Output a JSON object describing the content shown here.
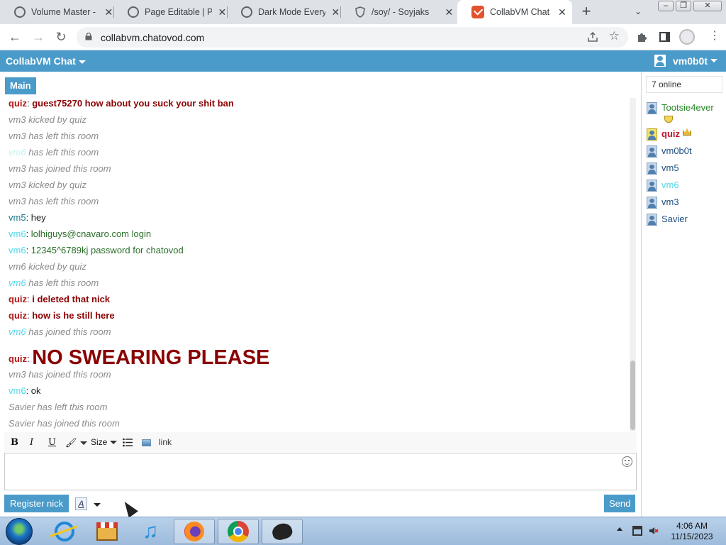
{
  "browser": {
    "tabs": [
      {
        "title": "Volume Master - h",
        "icon": "globe-icon"
      },
      {
        "title": "Page Editable | Pe",
        "icon": "globe-icon"
      },
      {
        "title": "Dark Mode Everyw",
        "icon": "globe-icon"
      },
      {
        "title": "/soy/ - Soyjaks",
        "icon": "shield-icon"
      },
      {
        "title": "CollabVM Chat",
        "icon": "collabvm-icon",
        "active": true
      }
    ],
    "new_tab_label": "+",
    "url": "collabvm.chatovod.com",
    "window_buttons": [
      "–",
      "❐",
      "✕"
    ]
  },
  "app": {
    "title": "CollabVM Chat",
    "username": "vm0b0t",
    "room_tab": "Main"
  },
  "messages": [
    {
      "type": "chat",
      "nick": "quiz",
      "text": "guest75270 how about you suck your shit ban",
      "nick_color": "#b01515",
      "text_color": "#8b0000",
      "style": "bold"
    },
    {
      "type": "system",
      "nick": "vm3",
      "text": "kicked by quiz"
    },
    {
      "type": "system",
      "nick": "vm3",
      "text": "has left this room"
    },
    {
      "type": "system",
      "nick": "vm6",
      "text": "has left this room",
      "nick_color": "#c9eef4"
    },
    {
      "type": "system",
      "nick": "vm3",
      "text": "has joined this room"
    },
    {
      "type": "system",
      "nick": "vm3",
      "text": "kicked by quiz"
    },
    {
      "type": "system",
      "nick": "vm3",
      "text": "has left this room"
    },
    {
      "type": "chat",
      "nick": "vm5",
      "text": "hey",
      "nick_color": "#1c7a8c",
      "text_color": "#222222"
    },
    {
      "type": "chat",
      "nick": "vm6",
      "text": "lolhiguys@cnavaro.com login",
      "nick_color": "#4fd7ea",
      "text_color": "#2a6e2a"
    },
    {
      "type": "chat",
      "nick": "vm6",
      "text": "12345^6789kj password for chatovod",
      "nick_color": "#4fd7ea",
      "text_color": "#2a6e2a"
    },
    {
      "type": "system",
      "nick": "vm6",
      "text": "kicked by quiz"
    },
    {
      "type": "system",
      "nick": "vm6",
      "text": "has left this room",
      "nick_color": "#4fd7ea"
    },
    {
      "type": "chat",
      "nick": "quiz",
      "text": "i deleted that nick",
      "nick_color": "#b01515",
      "text_color": "#8b0000",
      "style": "bold"
    },
    {
      "type": "chat",
      "nick": "quiz",
      "text": "how is he still here",
      "nick_color": "#b01515",
      "text_color": "#8b0000",
      "style": "bold"
    },
    {
      "type": "system",
      "nick": "vm6",
      "text": "has joined this room",
      "nick_color": "#4fd7ea"
    },
    {
      "type": "chat",
      "nick": "quiz",
      "text": "NO SWEARING PLEASE",
      "nick_color": "#b01515",
      "text_color": "#8b0000",
      "style": "big"
    },
    {
      "type": "system",
      "nick": "vm3",
      "text": "has joined this room"
    },
    {
      "type": "chat",
      "nick": "vm6",
      "text": "ok",
      "nick_color": "#4fd7ea",
      "text_color": "#222222"
    },
    {
      "type": "system",
      "nick": "Savier",
      "text": "has left this room"
    },
    {
      "type": "system",
      "nick": "Savier",
      "text": "has joined this room"
    }
  ],
  "composer": {
    "bold": "B",
    "italic": "I",
    "underline": "U",
    "size_label": "Size",
    "link_label": "link",
    "value": "",
    "register_label": "Register nick",
    "font_style_label": "A",
    "send_label": "Send"
  },
  "userlist": {
    "online_label": "7 online",
    "users": [
      {
        "name": "Tootsie4ever",
        "role": "moderator",
        "badge": "shield-badge-icon",
        "color": "#2a8a2a"
      },
      {
        "name": "quiz",
        "role": "admin",
        "badge": "crown-badge-icon",
        "color": "#c0142b"
      },
      {
        "name": "vm0b0t",
        "role": "user",
        "color": "#1e4f80"
      },
      {
        "name": "vm5",
        "role": "user",
        "color": "#1e4f80"
      },
      {
        "name": "vm6",
        "role": "user",
        "color": "#4fd7ea"
      },
      {
        "name": "vm3",
        "role": "user",
        "color": "#1e4f80"
      },
      {
        "name": "Savier",
        "role": "user",
        "color": "#1e4f80"
      }
    ]
  },
  "taskbar": {
    "apps": [
      "internet-explorer-icon",
      "store-icon",
      "music-icon",
      "firefox-icon",
      "chrome-icon",
      "collabvm-app-icon"
    ],
    "time": "4:06 AM",
    "date": "11/15/2023"
  },
  "colors": {
    "accent": "#4a9bc9",
    "admin": "#c0142b",
    "system_text": "#8a8a8a"
  }
}
